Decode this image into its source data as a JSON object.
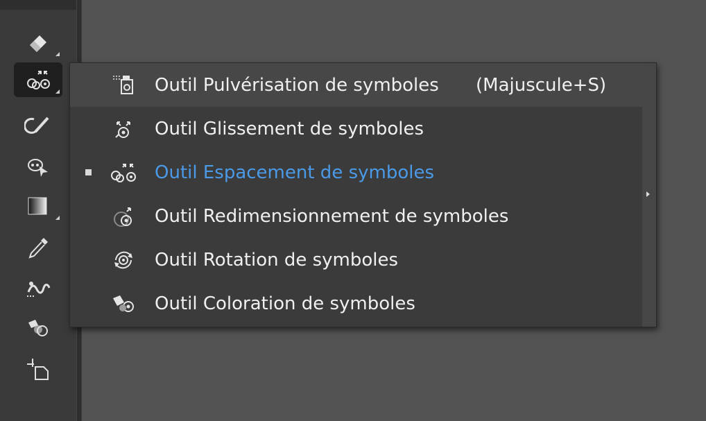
{
  "toolbar": {
    "tools": [
      {
        "name": "eraser-tool",
        "icon": "eraser-icon"
      },
      {
        "name": "symbol-sprayer-tool",
        "icon": "symbol-scruncher-icon",
        "active": true
      },
      {
        "name": "shaper-tool",
        "icon": "shaper-icon"
      },
      {
        "name": "zoom-select-tool",
        "icon": "magnify-pointer-icon"
      },
      {
        "name": "gradient-tool",
        "icon": "gradient-icon"
      },
      {
        "name": "eyedropper-tool",
        "icon": "eyedropper-icon"
      },
      {
        "name": "blend-tool",
        "icon": "blend-icon"
      },
      {
        "name": "live-paint-tool",
        "icon": "live-paint-icon"
      },
      {
        "name": "artboard-tool",
        "icon": "artboard-icon"
      }
    ]
  },
  "flyout": {
    "items": [
      {
        "label": "Outil Pulvérisation de symboles",
        "shortcut": "(Majuscule+S)",
        "icon": "symbol-sprayer-icon"
      },
      {
        "label": "Outil Glissement de symboles",
        "icon": "symbol-shifter-icon"
      },
      {
        "label": "Outil Espacement de symboles",
        "icon": "symbol-scruncher-icon",
        "selected": true
      },
      {
        "label": "Outil Redimensionnement de symboles",
        "icon": "symbol-sizer-icon"
      },
      {
        "label": "Outil Rotation de symboles",
        "icon": "symbol-spinner-icon"
      },
      {
        "label": "Outil Coloration de symboles",
        "icon": "symbol-stainer-icon"
      }
    ],
    "selected_color": "#4b9ae8"
  }
}
